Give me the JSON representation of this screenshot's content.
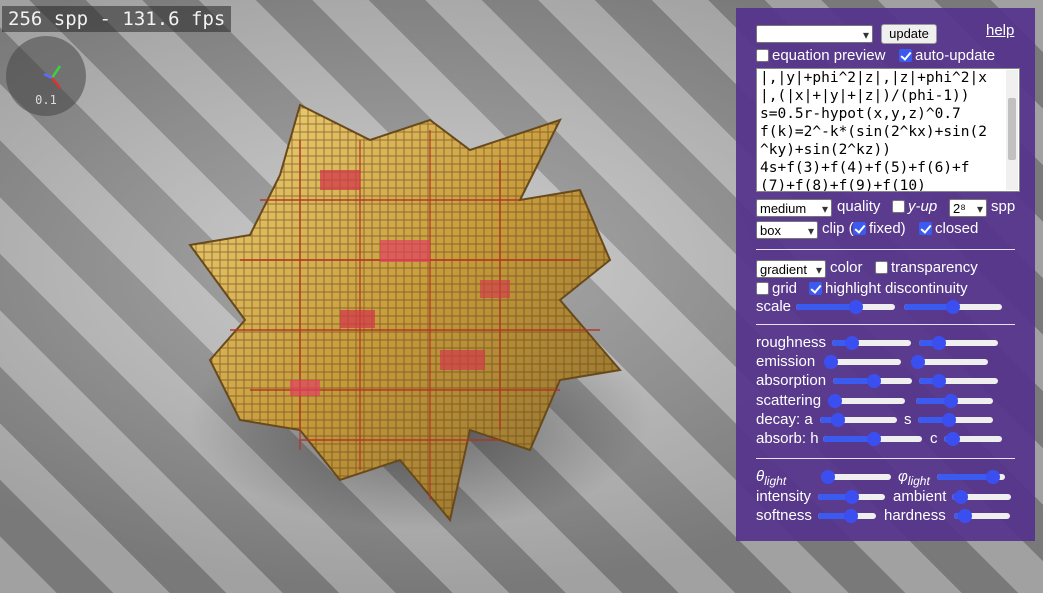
{
  "stats": {
    "fps_text": "256 spp - 131.6 fps"
  },
  "gizmo": {
    "value": "0.1"
  },
  "panel": {
    "preset_select_value": "",
    "update_label": "update",
    "help_label": "help",
    "equation_preview": {
      "label": "equation preview",
      "checked": false
    },
    "auto_update": {
      "label": "auto-update",
      "checked": true
    },
    "equation_lines": [
      "|,|y|+phi^2|z|,|z|+phi^2|x",
      "|,(|x|+|y|+|z|)/(phi-1))",
      "s=0.5r-hypot(x,y,z)^0.7",
      "f(k)=2^-k*(sin(2^kx)+sin(2",
      "^ky)+sin(2^kz))",
      "4s+f(3)+f(4)+f(5)+f(6)+f",
      "(7)+f(8)+f(9)+f(10)"
    ],
    "quality": {
      "select_value": "medium",
      "label": "quality"
    },
    "y_up": {
      "label": "y-up",
      "checked": false
    },
    "spp": {
      "select_value": "2⁸",
      "label": "spp"
    },
    "clip": {
      "select_value": "box",
      "label_pre": "clip (",
      "fixed_label": "fixed)",
      "fixed_checked": true,
      "closed_label": "closed",
      "closed_checked": true
    },
    "color": {
      "select_value": "gradient",
      "label": "color"
    },
    "transparency": {
      "label": "transparency",
      "checked": false
    },
    "grid": {
      "label": "grid",
      "checked": false
    },
    "highlight": {
      "label": "highlight discontinuity",
      "checked": true
    },
    "scale": {
      "label": "scale",
      "a": 0.62,
      "b": 0.5
    },
    "roughness": {
      "label": "roughness",
      "a": 0.2,
      "b": 0.2
    },
    "emission": {
      "label": "emission",
      "a": 0.0,
      "b": 0.0
    },
    "absorption": {
      "label": "absorption",
      "a": 0.52,
      "b": 0.2
    },
    "scattering": {
      "label": "scattering",
      "a": 0.0,
      "b": 0.45
    },
    "decay": {
      "label_a": "decay: a",
      "label_s": "s",
      "a": 0.18,
      "b": 0.4
    },
    "absorb": {
      "label_h": "absorb: h",
      "label_c": "c",
      "a": 0.52,
      "b": 0.05
    },
    "theta_light": {
      "symbol": "θ",
      "sub": "light",
      "value": 0.0
    },
    "phi_light": {
      "symbol": "φ",
      "sub": "light",
      "value": 0.9
    },
    "intensity": {
      "label": "intensity",
      "value": 0.5
    },
    "ambient": {
      "label": "ambient",
      "value": 0.05
    },
    "softness": {
      "label": "softness",
      "value": 0.6
    },
    "hardness": {
      "label": "hardness",
      "value": 0.1
    }
  },
  "colors": {
    "panel_bg": "#56348c",
    "accent": "#3b5af0",
    "fractal_gold": "#d9b24a",
    "fractal_red": "#c62c2c"
  }
}
